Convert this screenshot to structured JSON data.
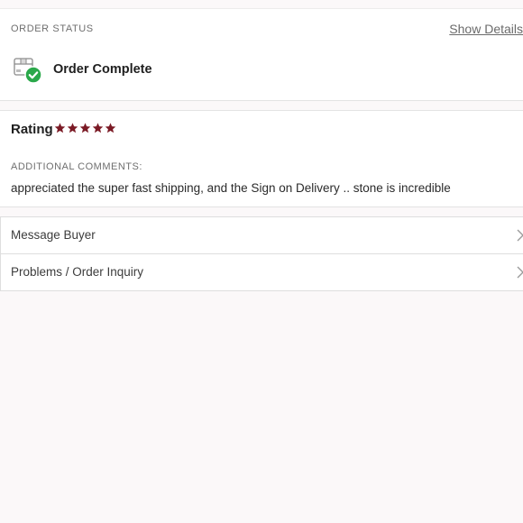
{
  "order_status": {
    "section_title": "ORDER STATUS",
    "show_details_label": "Show Details",
    "status_text": "Order Complete",
    "status_icon": "package-check-icon",
    "check_color": "#2aa84a"
  },
  "rating": {
    "label": "Rating",
    "stars": 5,
    "max_stars": 5,
    "star_color": "#7b1a25",
    "comments_title": "ADDITIONAL COMMENTS:",
    "comments_text": "appreciated the super fast shipping, and the Sign on Delivery .. stone is incredible"
  },
  "actions": [
    {
      "label": "Message Buyer",
      "icon": "chevron-right-icon"
    },
    {
      "label": "Problems / Order Inquiry",
      "icon": "chevron-right-icon"
    }
  ]
}
